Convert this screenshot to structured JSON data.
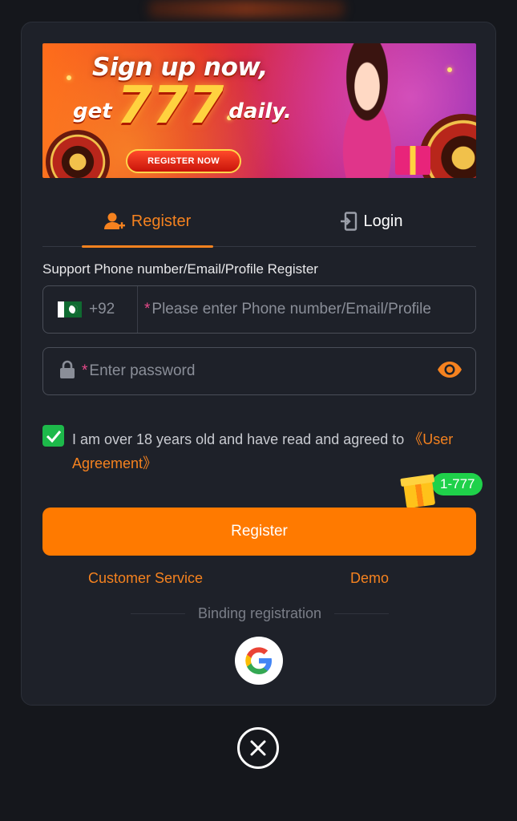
{
  "banner": {
    "headline": "Sign up now,",
    "sub_prefix": "get",
    "sub_number": "777",
    "sub_suffix": "daily.",
    "cta": "REGISTER NOW"
  },
  "tabs": [
    {
      "label": "Register",
      "icon": "user-add-icon",
      "active": true
    },
    {
      "label": "Login",
      "icon": "login-door-icon",
      "active": false
    }
  ],
  "form": {
    "support_label": "Support Phone number/Email/Profile Register",
    "country_flag": "pakistan-flag-icon",
    "dial_code": "+92",
    "required_mark": "*",
    "account_placeholder": "Please enter Phone number/Email/Profile",
    "password_placeholder": "Enter password"
  },
  "agreement": {
    "checked": true,
    "text": "I am over 18 years old and have read and agreed to ",
    "link": "《User Agreement》"
  },
  "bonus_badge": "1-777",
  "register_button": "Register",
  "links": {
    "customer_service": "Customer Service",
    "demo": "Demo"
  },
  "binding_label": "Binding registration",
  "colors": {
    "accent": "#ff7a00",
    "check": "#1db94a",
    "background": "#15171c",
    "panel": "#1e2129"
  }
}
